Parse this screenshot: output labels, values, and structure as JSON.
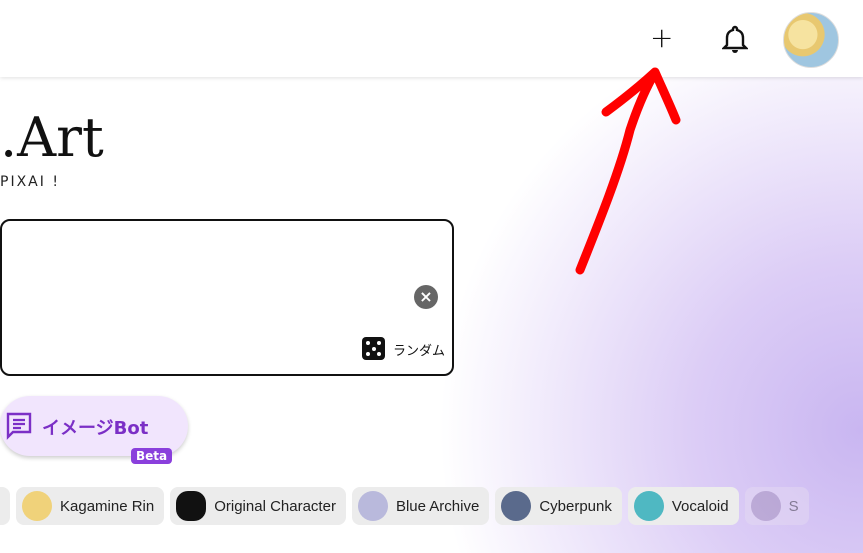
{
  "header": {
    "add_icon": "plus-icon",
    "notification_icon": "bell-icon",
    "avatar": "user-avatar"
  },
  "hero": {
    "title": ".Art",
    "subtitle": "PIXAI !"
  },
  "prompt": {
    "clear_icon": "close-circle-icon",
    "random_label": "ランダム",
    "random_icon": "dice-icon"
  },
  "bot": {
    "label": "イメージBot",
    "badge": "Beta",
    "icon": "chat-icon"
  },
  "chips": [
    {
      "label": "Kagamine Rin",
      "color": "#f0d27a"
    },
    {
      "label": "Original Character",
      "color": "#111111"
    },
    {
      "label": "Blue Archive",
      "color": "#b9b9dc"
    },
    {
      "label": "Cyberpunk",
      "color": "#5a6a8c"
    },
    {
      "label": "Vocaloid",
      "color": "#4fb8c2"
    },
    {
      "label": "S",
      "color": "#9b86b3"
    }
  ],
  "annotation": {
    "color": "#ff0000"
  }
}
